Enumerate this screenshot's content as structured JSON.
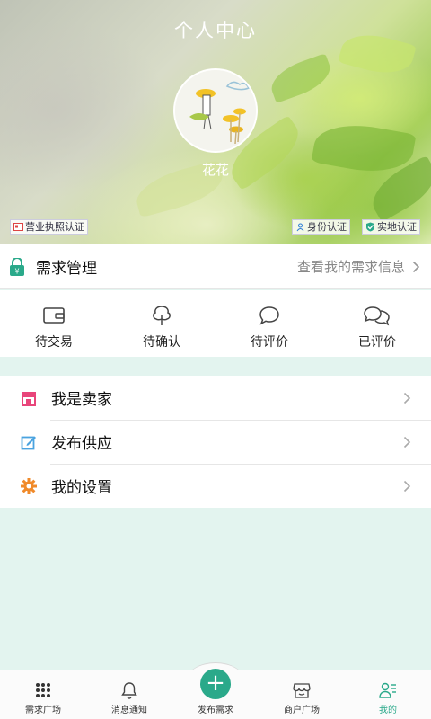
{
  "header": {
    "title": "个人中心",
    "username": "花花",
    "badges": {
      "business_license": "营业执照认证",
      "identity": "身份认证",
      "onsite": "实地认证"
    }
  },
  "demand": {
    "label": "需求管理",
    "link": "查看我的需求信息"
  },
  "status_items": [
    {
      "label": "待交易",
      "icon": "wallet-icon"
    },
    {
      "label": "待确认",
      "icon": "tree-icon"
    },
    {
      "label": "待评价",
      "icon": "chat-bubble-icon"
    },
    {
      "label": "已评价",
      "icon": "chat-bubbles-icon"
    }
  ],
  "menu": [
    {
      "label": "我是卖家",
      "icon": "shop-icon",
      "color": "#e8457a"
    },
    {
      "label": "发布供应",
      "icon": "edit-icon",
      "color": "#4aa3e0"
    },
    {
      "label": "我的设置",
      "icon": "gear-icon",
      "color": "#f08a2a"
    }
  ],
  "tabbar": [
    {
      "label": "需求广场",
      "icon": "grid-dots-icon"
    },
    {
      "label": "消息通知",
      "icon": "bell-icon"
    },
    {
      "label": "发布需求",
      "icon": "plus-icon"
    },
    {
      "label": "商户广场",
      "icon": "store-icon"
    },
    {
      "label": "我的",
      "icon": "user-list-icon",
      "active": true
    }
  ],
  "colors": {
    "accent": "#2aa98a",
    "background": "#e3f4ef"
  }
}
